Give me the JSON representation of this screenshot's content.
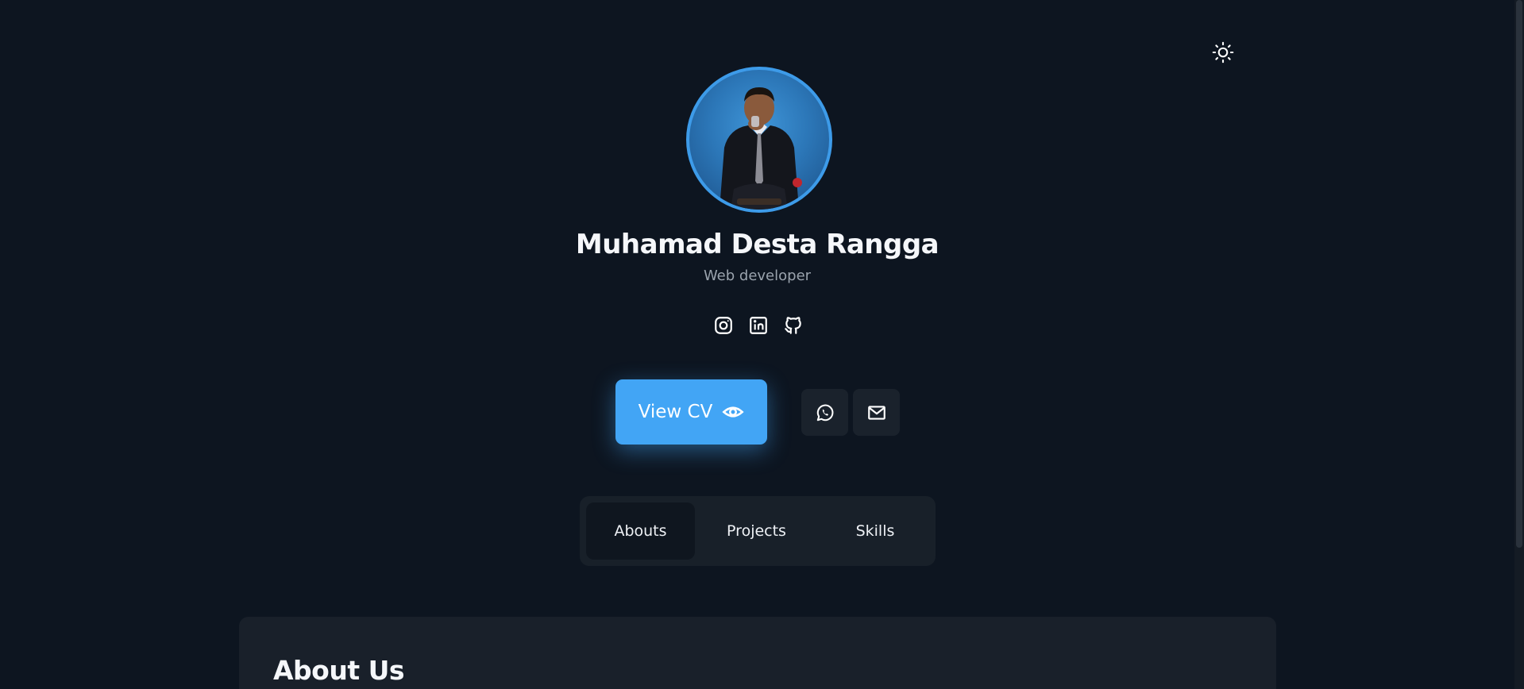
{
  "theme_toggle": {
    "icon": "sun-icon"
  },
  "profile": {
    "name": "Muhamad Desta Rangga",
    "role": "Web developer",
    "avatar": "profile-photo"
  },
  "socials": [
    {
      "icon": "instagram-icon"
    },
    {
      "icon": "linkedin-icon"
    },
    {
      "icon": "github-icon"
    }
  ],
  "actions": {
    "cv_label": "View CV",
    "cv_icon": "eye-icon",
    "whatsapp_icon": "whatsapp-icon",
    "email_icon": "mail-icon"
  },
  "tabs": [
    {
      "label": "Abouts",
      "active": true
    },
    {
      "label": "Projects",
      "active": false
    },
    {
      "label": "Skills",
      "active": false
    }
  ],
  "about": {
    "title": "About Us"
  },
  "colors": {
    "background": "#0d1520",
    "accent": "#42a5f5",
    "card": "#19202a",
    "muted_text": "#9aa3ad"
  }
}
